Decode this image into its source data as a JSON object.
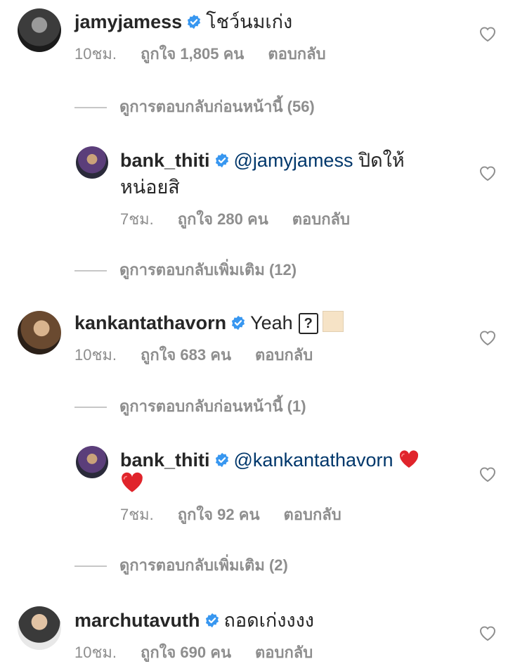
{
  "comments": [
    {
      "username": "jamyjamess",
      "text": "โชว์นมเก่ง",
      "time": "10ชม.",
      "likes": "ถูกใจ 1,805 คน",
      "reply": "ตอบกลับ",
      "replies_link": "ดูการตอบกลับก่อนหน้านี้ (56)",
      "nested": {
        "username": "bank_thiti",
        "mention": "@jamyjamess",
        "text_line1": "ปิดให้",
        "text_line2": "หน่อยสิ",
        "time": "7ชม.",
        "likes": "ถูกใจ 280 คน",
        "reply": "ตอบกลับ"
      },
      "more_replies": "ดูการตอบกลับเพิ่มเติม (12)"
    },
    {
      "username": "kankantathavorn",
      "text": "Yeah",
      "unknown_glyph": "?",
      "time": "10ชม.",
      "likes": "ถูกใจ 683 คน",
      "reply": "ตอบกลับ",
      "replies_link": "ดูการตอบกลับก่อนหน้านี้ (1)",
      "nested": {
        "username": "bank_thiti",
        "mention": "@kankantathavorn",
        "time": "7ชม.",
        "likes": "ถูกใจ 92 คน",
        "reply": "ตอบกลับ"
      },
      "more_replies": "ดูการตอบกลับเพิ่มเติม (2)"
    },
    {
      "username": "marchutavuth",
      "text": "ถอดเก่งงงง",
      "time": "10ชม.",
      "likes": "ถูกใจ 690 คน",
      "reply": "ตอบกลับ"
    }
  ],
  "icons": {
    "verified": "verified-badge-icon",
    "like": "heart-outline-icon",
    "emoji": "red-heart-emoji"
  },
  "colors": {
    "verified_blue": "#3897f0",
    "mention_blue": "#00376b",
    "meta_gray": "#8e8e8e",
    "heart_red": "#e0242b"
  }
}
